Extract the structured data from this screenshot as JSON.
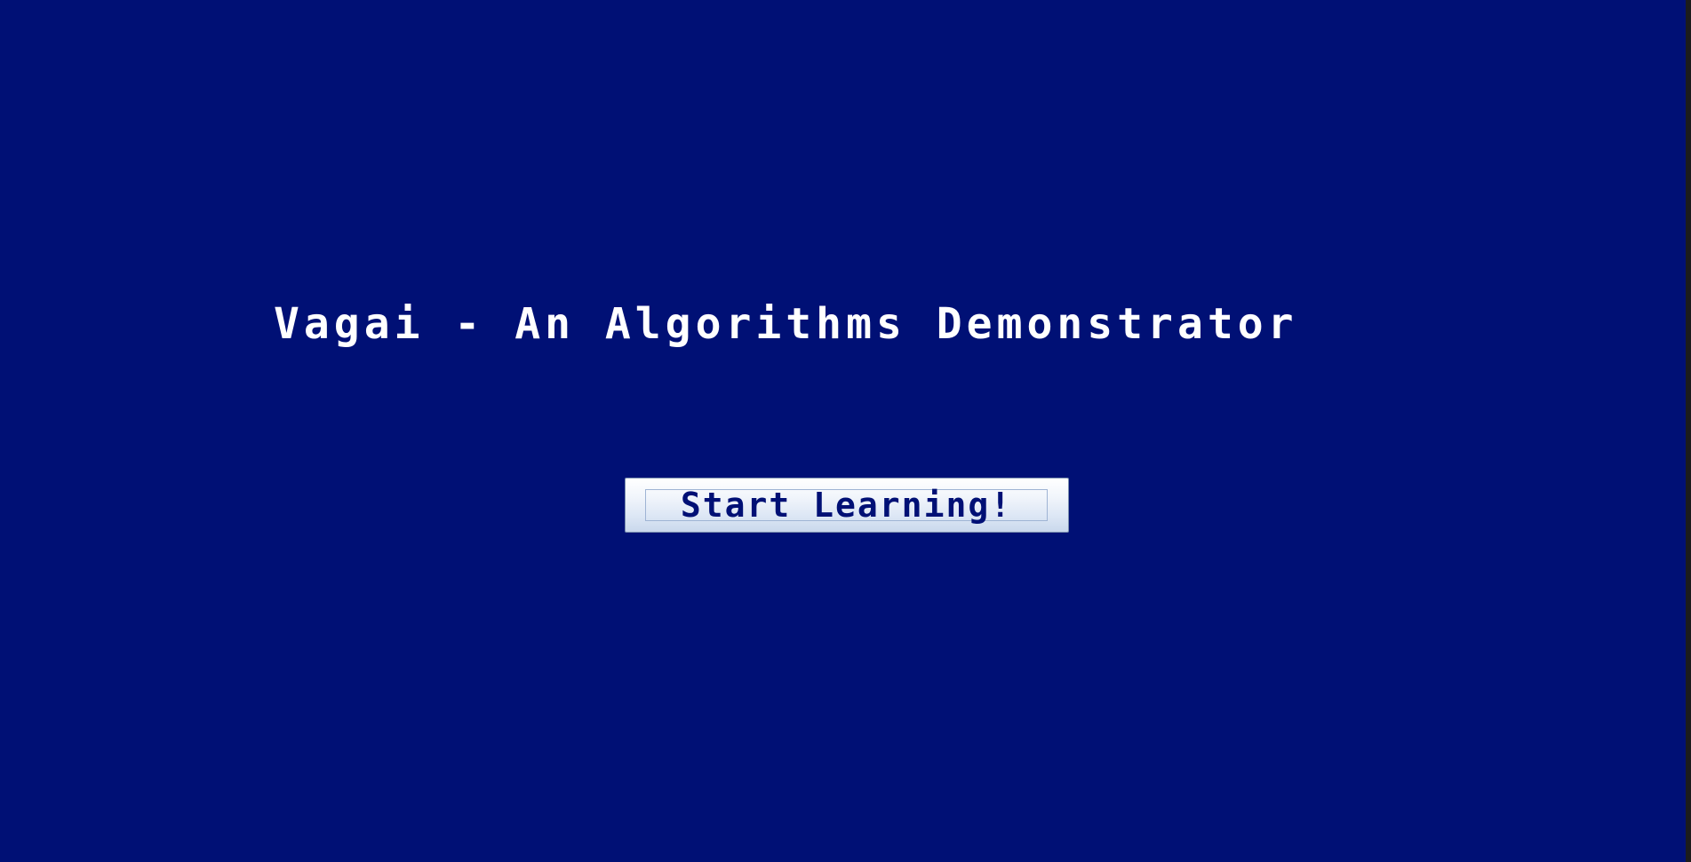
{
  "app": {
    "title": "Vagai - An Algorithms Demonstrator",
    "background_color": "#001075"
  },
  "start_button": {
    "label": "Start Learning!",
    "text_color": "#001075"
  }
}
